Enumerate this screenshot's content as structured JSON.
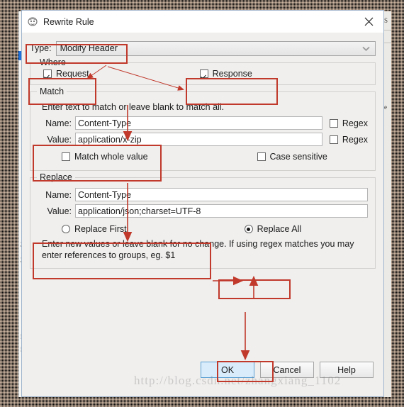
{
  "window": {
    "title": "Rewrite Rule",
    "icon": "app-icon",
    "close_label": "×"
  },
  "type_row": {
    "label": "Type:",
    "value": "Modify Header",
    "chevron": "chevron-down-icon",
    "options": [
      "Modify Header"
    ]
  },
  "where": {
    "title": "Where",
    "request": {
      "label": "Request",
      "checked": true
    },
    "response": {
      "label": "Response",
      "checked": true
    }
  },
  "match": {
    "title": "Match",
    "hint": "Enter text to match or leave blank to match all.",
    "name_label": "Name:",
    "name_value": "Content-Type",
    "value_label": "Value:",
    "value_value": "application/x-zip",
    "regex_name_label": "Regex",
    "regex_name_checked": false,
    "regex_value_label": "Regex",
    "regex_value_checked": false,
    "whole_value_label": "Match whole value",
    "whole_value_checked": false,
    "case_sensitive_label": "Case sensitive",
    "case_sensitive_checked": false
  },
  "replace": {
    "title": "Replace",
    "name_label": "Name:",
    "name_value": "Content-Type",
    "value_label": "Value:",
    "value_value": "application/json;charset=UTF-8",
    "replace_first_label": "Replace First",
    "replace_first_selected": false,
    "replace_all_label": "Replace All",
    "replace_all_selected": true,
    "note": "Enter new values or leave blank for no change. If using regex matches you may enter references to groups, eg. $1"
  },
  "buttons": {
    "ok": "OK",
    "cancel": "Cancel",
    "help": "Help"
  },
  "watermark": "http://blog.csdn.net/zhangxiang_1102",
  "background": {
    "left_digits": [
      "2",
      "21",
      "5",
      "5"
    ],
    "right_text": [
      "S",
      "e"
    ]
  },
  "colors": {
    "annotation": "#c0392b",
    "dialog_bg": "#f0efee",
    "default_button": "#d9ecfb",
    "selection": "#1e6fd9"
  }
}
